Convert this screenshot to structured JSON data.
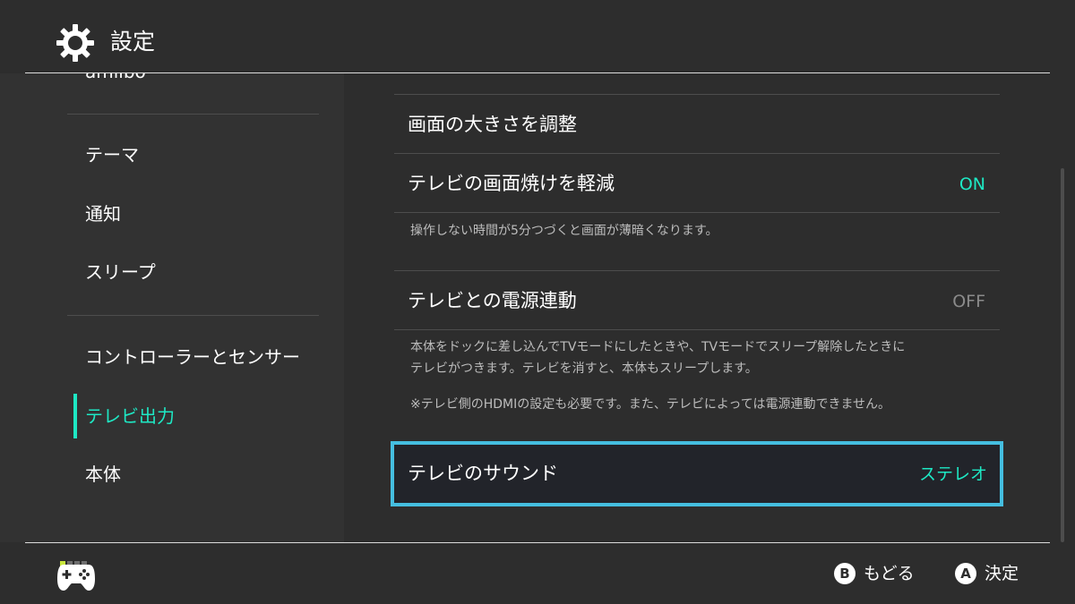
{
  "header": {
    "title": "設定",
    "icon": "gear-icon"
  },
  "sidebar": {
    "cut_item": "amiibo",
    "items": [
      {
        "label": "テーマ"
      },
      {
        "label": "通知"
      },
      {
        "label": "スリープ"
      },
      {
        "label": "コントローラーとセンサー"
      },
      {
        "label": "テレビ出力",
        "active": true
      },
      {
        "label": "本体"
      }
    ]
  },
  "main": {
    "rows": [
      {
        "label": "画面の大きさを調整",
        "value": ""
      },
      {
        "label": "テレビの画面焼けを軽減",
        "value": "ON"
      },
      {
        "label": "テレビとの電源連動",
        "value": "OFF"
      },
      {
        "label": "テレビのサウンド",
        "value": "ステレオ"
      }
    ],
    "desc_burn": "操作しない時間が5分つづくと画面が薄暗くなります。",
    "desc_power_1": "本体をドックに差し込んでTVモードにしたときや、TVモードでスリープ解除したときに",
    "desc_power_2": "テレビがつきます。テレビを消すと、本体もスリープします。",
    "desc_power_3": "※テレビ側のHDMIの設定も必要です。また、テレビによっては電源連動できません。"
  },
  "footer": {
    "back_key": "B",
    "back_label": "もどる",
    "ok_key": "A",
    "ok_label": "決定"
  },
  "colors": {
    "background": "#2d2d2d",
    "accent": "#1ee8c4",
    "selection_border": "#45bee0",
    "off_text": "#8a8a8a"
  }
}
